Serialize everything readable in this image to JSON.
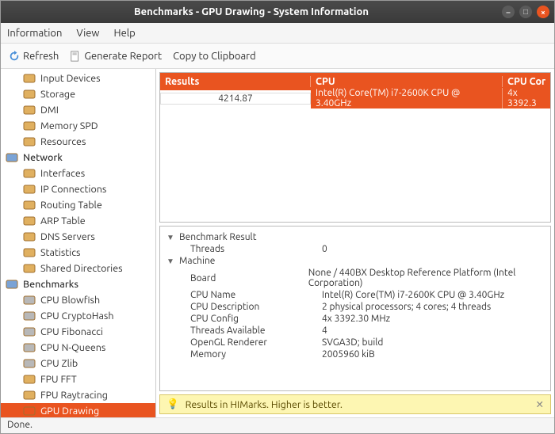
{
  "window": {
    "title": "Benchmarks - GPU Drawing - System Information"
  },
  "menubar": {
    "items": [
      "Information",
      "View",
      "Help"
    ]
  },
  "toolbar": {
    "refresh": "Refresh",
    "report": "Generate Report",
    "copy": "Copy to Clipboard"
  },
  "sidebar": {
    "groups": [
      {
        "label": "",
        "items": [
          {
            "icon": "keyboard-icon",
            "label": "Input Devices"
          },
          {
            "icon": "storage-icon",
            "label": "Storage"
          },
          {
            "icon": "dmi-icon",
            "label": "DMI"
          },
          {
            "icon": "memory-icon",
            "label": "Memory SPD"
          },
          {
            "icon": "resources-icon",
            "label": "Resources"
          }
        ]
      },
      {
        "label": "Network",
        "icon": "network-icon",
        "items": [
          {
            "icon": "interfaces-icon",
            "label": "Interfaces"
          },
          {
            "icon": "ip-icon",
            "label": "IP Connections"
          },
          {
            "icon": "routing-icon",
            "label": "Routing Table"
          },
          {
            "icon": "arp-icon",
            "label": "ARP Table"
          },
          {
            "icon": "dns-icon",
            "label": "DNS Servers"
          },
          {
            "icon": "stats-icon",
            "label": "Statistics"
          },
          {
            "icon": "shared-icon",
            "label": "Shared Directories"
          }
        ]
      },
      {
        "label": "Benchmarks",
        "icon": "benchmarks-icon",
        "items": [
          {
            "icon": "cpu-icon",
            "label": "CPU Blowfish"
          },
          {
            "icon": "cpu-icon",
            "label": "CPU CryptoHash"
          },
          {
            "icon": "cpu-icon",
            "label": "CPU Fibonacci"
          },
          {
            "icon": "cpu-icon",
            "label": "CPU N-Queens"
          },
          {
            "icon": "cpu-icon",
            "label": "CPU Zlib"
          },
          {
            "icon": "fpu-icon",
            "label": "FPU FFT"
          },
          {
            "icon": "fpu-icon",
            "label": "FPU Raytracing"
          },
          {
            "icon": "gpu-icon",
            "label": "GPU Drawing",
            "selected": true
          }
        ]
      }
    ]
  },
  "results": {
    "headers": {
      "results": "Results",
      "cpu": "CPU",
      "cpuconfig": "CPU Cor"
    },
    "rows": [
      {
        "result": "4214.87",
        "cpu": "Intel(R) Core(TM) i7-2600K CPU @ 3.40GHz",
        "cfg": "4x 3392.3"
      }
    ]
  },
  "detail": {
    "sections": [
      {
        "title": "Benchmark Result",
        "rows": [
          {
            "k": "Threads",
            "v": "0"
          }
        ]
      },
      {
        "title": "Machine",
        "rows": [
          {
            "k": "Board",
            "v": "None / 440BX Desktop Reference Platform (Intel Corporation)"
          },
          {
            "k": "CPU Name",
            "v": "Intel(R) Core(TM) i7-2600K CPU @ 3.40GHz"
          },
          {
            "k": "CPU Description",
            "v": "2 physical processors; 4 cores; 4 threads"
          },
          {
            "k": "CPU Config",
            "v": "4x 3392.30 MHz"
          },
          {
            "k": "Threads Available",
            "v": "4"
          },
          {
            "k": "OpenGL Renderer",
            "v": "SVGA3D; build"
          },
          {
            "k": "Memory",
            "v": "2005960 kiB"
          }
        ]
      }
    ]
  },
  "hint": {
    "text": "Results in HIMarks. Higher is better."
  },
  "status": {
    "text": "Done."
  }
}
